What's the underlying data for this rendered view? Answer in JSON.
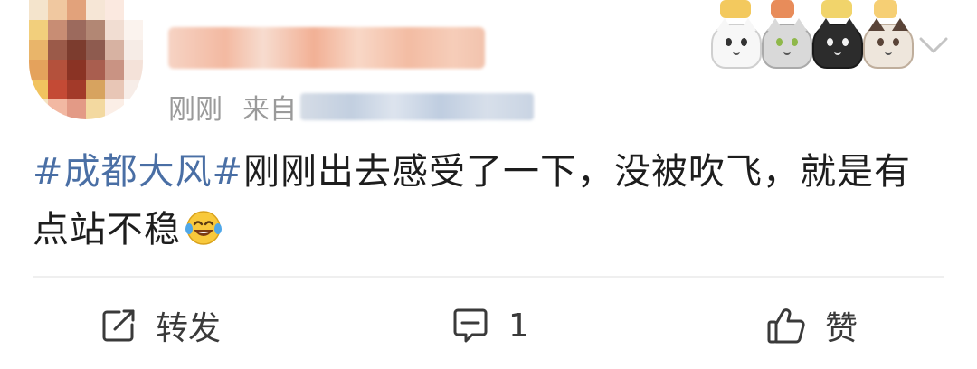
{
  "post": {
    "author": {
      "name": "",
      "avatar": "avatar"
    },
    "meta": {
      "time": "刚刚",
      "source_prefix": "来自"
    },
    "body": {
      "hashtag": "#成都大风#",
      "text": "刚刚出去感受了一下，没被吹飞，就是有点站不稳",
      "emoji": "laughing-tears-emoji"
    }
  },
  "header": {
    "stickers": [
      "white-cat-sticker",
      "grey-cat-sticker",
      "black-cat-sticker",
      "siamese-cat-sticker"
    ],
    "menu_icon": "chevron-down-icon"
  },
  "actions": {
    "share_label": "转发",
    "comment_count": "1",
    "like_label": "赞"
  },
  "colors": {
    "hashtag": "#4a6fa5",
    "meta_text": "#9a9a9a",
    "icon": "#3a3a3a"
  }
}
